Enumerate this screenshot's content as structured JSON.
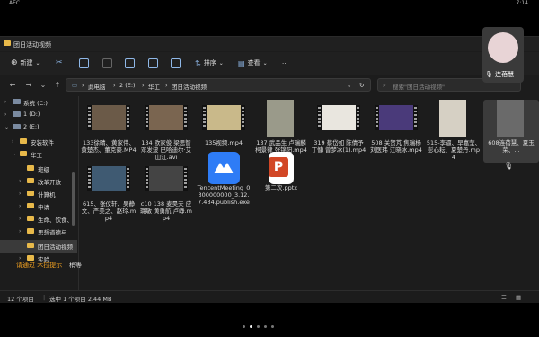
{
  "statusbar": {
    "left": "AEC ...",
    "right": "7:14"
  },
  "window": {
    "title": "团日活动视频"
  },
  "cmdbar": {
    "new_label": "新建",
    "sort_label": "排序",
    "view_label": "查看",
    "more_label": "..."
  },
  "addressbar": {
    "crumbs": [
      "此电脑",
      "2 (E:)",
      "华工",
      "团日活动视频"
    ],
    "search_placeholder": "搜索\"团日活动视频\""
  },
  "sidebar": {
    "items": [
      {
        "label": "系统 (C:)",
        "kind": "drive"
      },
      {
        "label": "1 (D:)",
        "kind": "drive"
      },
      {
        "label": "2 (E:)",
        "kind": "drive"
      },
      {
        "label": "安装软件",
        "kind": "folder"
      },
      {
        "label": "华工",
        "kind": "folder"
      },
      {
        "label": "班级",
        "kind": "folder"
      },
      {
        "label": "改革开放",
        "kind": "folder"
      },
      {
        "label": "计算机",
        "kind": "folder"
      },
      {
        "label": "申请",
        "kind": "folder"
      },
      {
        "label": "生命、饮食、",
        "kind": "folder"
      },
      {
        "label": "思想道德与",
        "kind": "folder"
      },
      {
        "label": "团日活动视频",
        "kind": "folder"
      },
      {
        "label": "实验",
        "kind": "folder"
      }
    ]
  },
  "overlay": {
    "orange": "请通过 木拉提示",
    "white": "稍等"
  },
  "files": [
    {
      "name": "133徐晴、黄家伟、黄楚杰、董克豪.MP4",
      "kind": "video",
      "color": "#6b5a48"
    },
    {
      "name": "134 欧家俊 梁思智 邓发波 巴哈迪尔·艾山江.avi",
      "kind": "video",
      "color": "#7a6550"
    },
    {
      "name": "135视频.mp4",
      "kind": "video",
      "color": "#c9b98a"
    },
    {
      "name": "137 武品生 卢瑞麟 柯景律 张锦阳.mp4",
      "kind": "video-tall",
      "color": "#9a9a8a"
    },
    {
      "name": "319 蔡岱如 陈倩予 丁慷 曾梦冰(1).mp4",
      "kind": "video",
      "color": "#e9e6df"
    },
    {
      "name": "508 关贺芃 焦瑞杨 刘医玮 江晓冰.mp4",
      "kind": "video",
      "color": "#4a3a7a"
    },
    {
      "name": "515-李逼、早嘉莹、彭心耘、夏楚丹.mp4",
      "kind": "video-tall",
      "color": "#d6d0c4"
    },
    {
      "name": "608连蓓慧、夏玉荣、...",
      "kind": "video-tall",
      "color": "#6a6a6a"
    },
    {
      "name": "615、张仪轩、吴静文、严美之、赵玲.mp4",
      "kind": "video",
      "color": "#3f5a72"
    },
    {
      "name": "c10 138 麦昊天 应璐敏 黄勇航 卢峥.mp4",
      "kind": "video",
      "color": "#444"
    },
    {
      "name": "TencentMeeting_0300000000_3.12.7.434.publish.exe",
      "kind": "app-tencent",
      "color": "#2e7cf6"
    },
    {
      "name": "第二次.pptx",
      "kind": "app-pptx",
      "color": "#d24726"
    }
  ],
  "status": {
    "count": "12 个项目",
    "selected": "选中 1 个项目 2.44 MB"
  },
  "participant": {
    "name": "连蓓慧"
  }
}
